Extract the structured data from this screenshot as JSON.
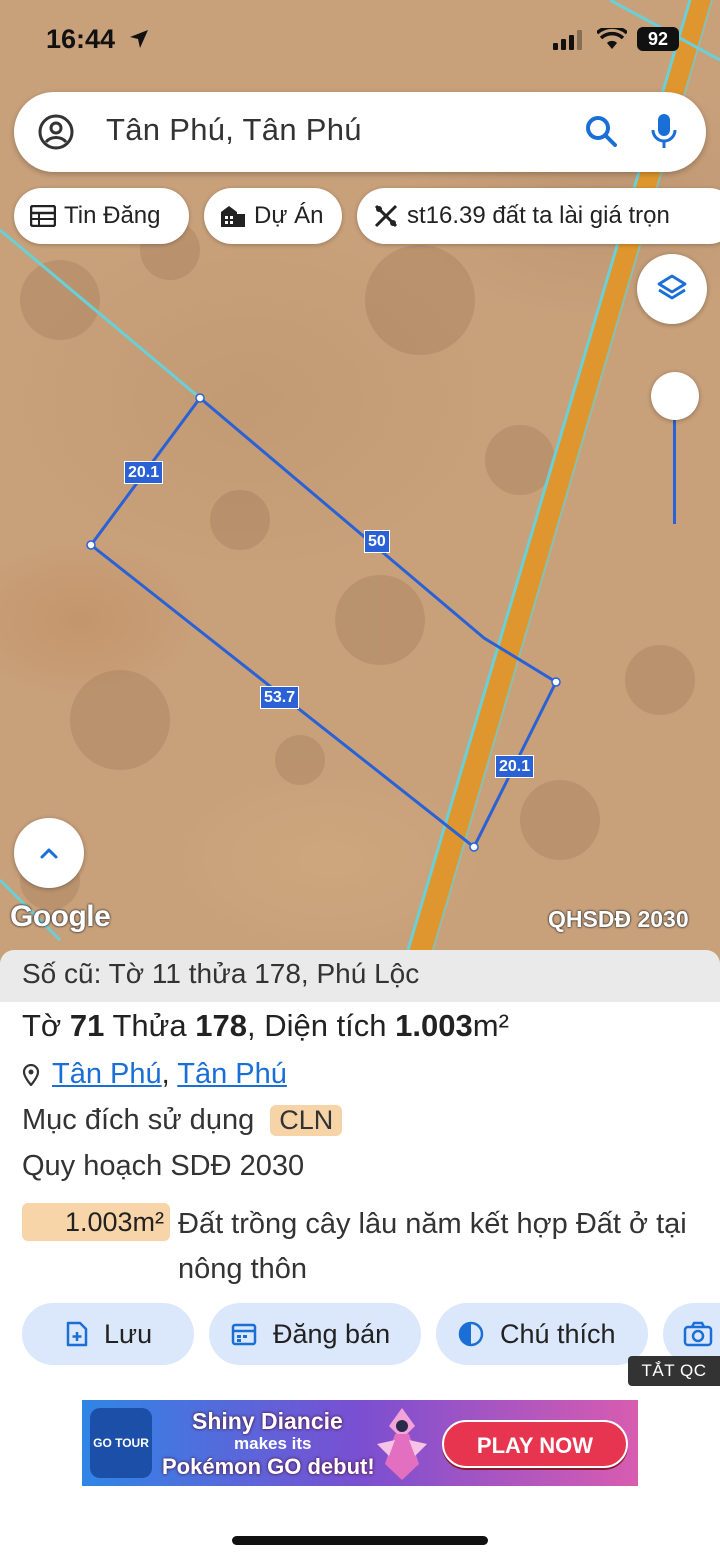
{
  "status_bar": {
    "time": "16:44",
    "battery": "92"
  },
  "search": {
    "query": "Tân Phú, Tân Phú"
  },
  "chips": [
    {
      "label": "Tin Đăng",
      "icon": "listing-icon"
    },
    {
      "label": "Dự Án",
      "icon": "building-icon"
    },
    {
      "label": "st16.39 đất ta lài giá trọn",
      "icon": "pattern-icon"
    }
  ],
  "map": {
    "plot_edges": [
      "20.1",
      "50",
      "53.7",
      "20.1"
    ],
    "google_label": "Google",
    "layer_label": "QHSDĐ 2030"
  },
  "sheet": {
    "old_ref": "Số cũ: Tờ 11 thửa 178, Phú Lộc",
    "to_label": "Tờ",
    "to_value": "71",
    "thua_label": "Thửa",
    "thua_value": "178",
    "area_label": "Diện tích",
    "area_value": "1.003",
    "area_unit": "m²",
    "location_1": "Tân Phú",
    "location_2": "Tân Phú",
    "purpose_label": "Mục đích sử dụng",
    "purpose_code": "CLN",
    "plan_label": "Quy hoạch SDĐ 2030",
    "plan_area": "1.003m²",
    "plan_desc": "Đất trồng cây lâu năm kết hợp Đất ở tại nông thôn"
  },
  "actions": [
    {
      "label": "Lưu",
      "icon": "save-doc-icon"
    },
    {
      "label": "Đăng bán",
      "icon": "calendar-icon"
    },
    {
      "label": "Chú thích",
      "icon": "contrast-icon"
    },
    {
      "label": "",
      "icon": "camera-icon"
    }
  ],
  "ad": {
    "close_label": "TẮT QC",
    "logo_text": "GO TOUR",
    "line1": "Shiny Diancie",
    "line2": "makes its",
    "line3": "Pokémon GO debut!",
    "cta": "PLAY NOW"
  },
  "colors": {
    "accent": "#1a6fd6",
    "plot_line": "#2a62d6",
    "chip_bg": "#dbe7fb",
    "badge": "#f7d4a8",
    "road": "#e0962e"
  }
}
